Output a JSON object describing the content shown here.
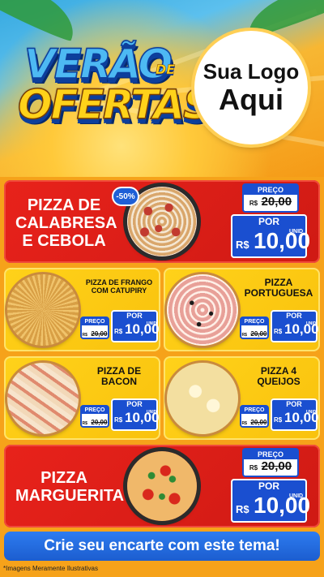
{
  "header": {
    "title_line1": "VERÃO",
    "title_de": "DE",
    "title_line2": "OFERTAS",
    "logo_line1": "Sua Logo",
    "logo_line2": "Aqui"
  },
  "featured": [
    {
      "id": "calabresa",
      "name": "PIZZA DE CALABRESA E CEBOLA",
      "discount": "-50%",
      "old_label": "PREÇO",
      "old_currency": "R$",
      "old_price": "20,00",
      "new_label": "POR",
      "new_currency": "R$",
      "new_amount": "10,00",
      "unit": "UNID"
    },
    {
      "id": "marguerita",
      "name": "PIZZA MARGUERITA",
      "old_label": "PREÇO",
      "old_currency": "R$",
      "old_price": "20,00",
      "new_label": "POR",
      "new_currency": "R$",
      "new_amount": "10,00",
      "unit": "UNID"
    }
  ],
  "grid": [
    {
      "id": "frango",
      "name": "PIZZA DE FRANGO COM CATUPIRY",
      "old_label": "PREÇO",
      "old_currency": "R$",
      "old_price": "20,00",
      "new_label": "POR",
      "new_currency": "R$",
      "new_amount": "10,00",
      "unit": "UNID"
    },
    {
      "id": "portuguesa",
      "name": "PIZZA PORTUGUESA",
      "old_label": "PREÇO",
      "old_currency": "R$",
      "old_price": "20,00",
      "new_label": "POR",
      "new_currency": "R$",
      "new_amount": "10,00",
      "unit": "UNID"
    },
    {
      "id": "bacon",
      "name": "PIZZA DE BACON",
      "old_label": "PREÇO",
      "old_currency": "R$",
      "old_price": "20,00",
      "new_label": "POR",
      "new_currency": "R$",
      "new_amount": "10,00",
      "unit": "UNID"
    },
    {
      "id": "queijos",
      "name": "PIZZA 4 QUEIJOS",
      "old_label": "PREÇO",
      "old_currency": "R$",
      "old_price": "20,00",
      "new_label": "POR",
      "new_currency": "R$",
      "new_amount": "10,00",
      "unit": "UNID"
    }
  ],
  "cta": "Crie seu encarte com este tema!",
  "disclaimer": "*Imagens Meramente Ilustrativas",
  "colors": {
    "red_panel": "#e8221b",
    "yellow_panel": "#ffd21a",
    "blue_tag": "#1a4fd0",
    "background": "#f6a21a"
  }
}
